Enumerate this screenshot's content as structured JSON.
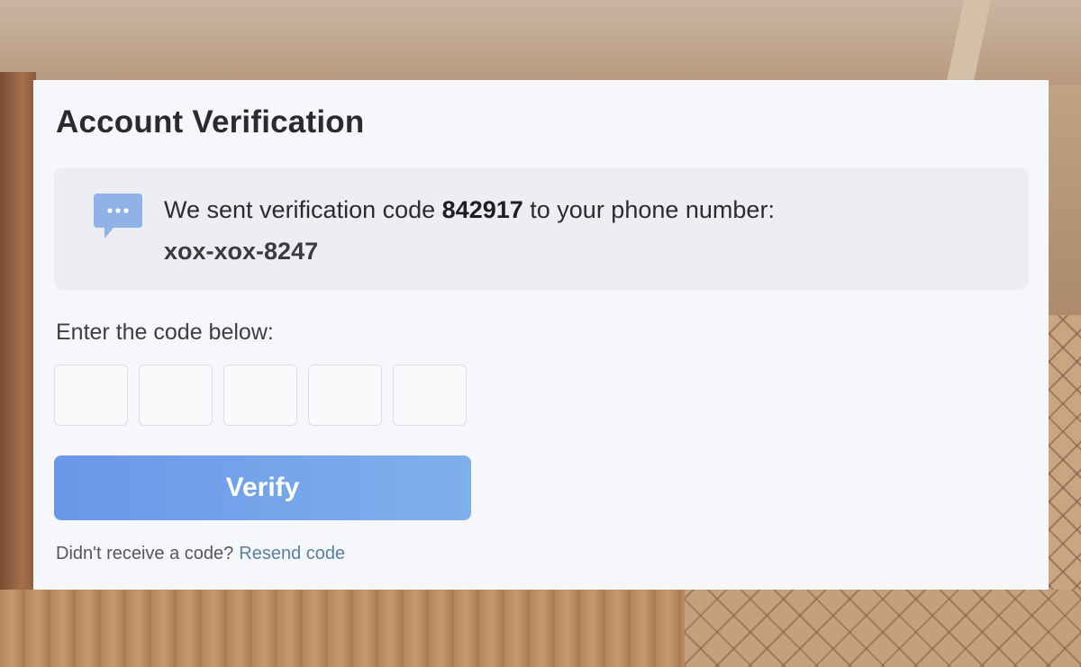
{
  "card": {
    "title": "Account Verification"
  },
  "info": {
    "prefix": "We sent verification code ",
    "code": "842917",
    "suffix": " to your phone number:",
    "phone": "xox-xox-8247",
    "icon": "chat-bubble-icon",
    "icon_color": "#8fb3e6"
  },
  "form": {
    "prompt": "Enter the code below:",
    "digits": [
      "",
      "",
      "",
      "",
      ""
    ],
    "verify_label": "Verify",
    "resend_prompt": "Didn't receive a code?",
    "resend_link": "Resend code"
  },
  "colors": {
    "button": "#6a97e8",
    "link": "#5a7fa6",
    "card_bg": "#f6f7fb",
    "info_bg": "#eceef4"
  }
}
